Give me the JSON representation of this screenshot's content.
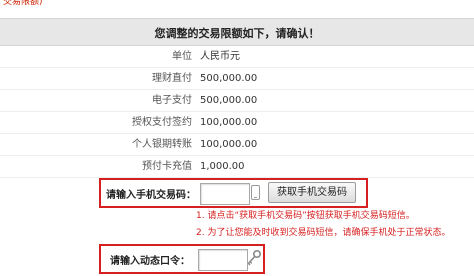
{
  "top_text": "交易限额)",
  "header": {
    "title": "您调整的交易限额如下，请确认！"
  },
  "rows": [
    {
      "label": "单位",
      "value": "人民币元"
    },
    {
      "label": "理财直付",
      "value": "500,000.00"
    },
    {
      "label": "电子支付",
      "value": "500,000.00"
    },
    {
      "label": "授权支付签约",
      "value": "100,000.00"
    },
    {
      "label": "个人银期转账",
      "value": "100,000.00"
    },
    {
      "label": "预付卡充值",
      "value": "1,000.00"
    }
  ],
  "sms": {
    "label": "请输入手机交易码：",
    "input_value": "",
    "button_label": "获取手机交易码",
    "hints": [
      "1. 请点击“获取手机交易码”按钮获取手机交易码短信。",
      "2. 为了让您能及时收到交易码短信，请确保手机处于正常状态。"
    ]
  },
  "dynamic": {
    "label": "请输入动态口令：",
    "input_value": ""
  },
  "colors": {
    "highlight_border": "#d61f1f",
    "hint_text": "#d61f1f",
    "header_bg": "#e7e7e7"
  }
}
